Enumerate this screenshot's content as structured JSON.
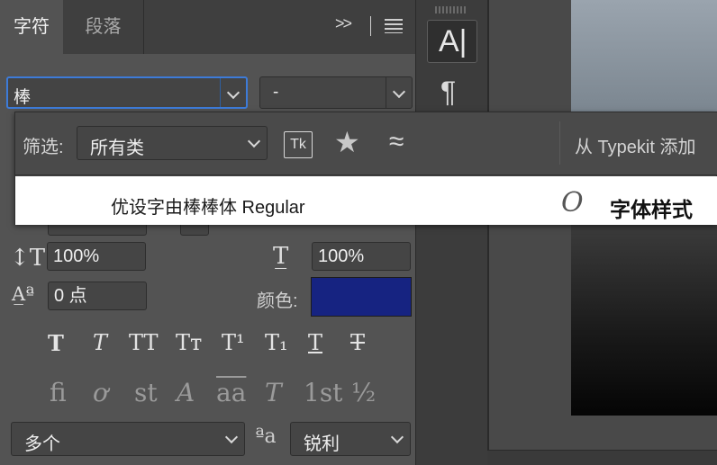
{
  "tabs": [
    "字符",
    "段落"
  ],
  "panel_controls": {
    "expand": ">>",
    "menu": "panel-menu-icon"
  },
  "font_family": {
    "value": "棒"
  },
  "font_style": {
    "value": "-"
  },
  "vertical_scale": "100%",
  "horizontal_scale": "100%",
  "baseline_shift": "0 点",
  "color": {
    "label": "颜色:",
    "swatch": "#162381"
  },
  "type_buttons": [
    "T",
    "T",
    "TT",
    "Tт",
    "T¹",
    "T₁",
    "T",
    "T"
  ],
  "opentype_buttons": [
    "ﬁ",
    "ơ",
    "st",
    "A",
    "aa",
    "T",
    "1st",
    "½"
  ],
  "language": {
    "value": "多个"
  },
  "anti_alias": {
    "icon": "ªa",
    "value": "锐利"
  },
  "side_strip": {
    "character_button": "A|",
    "paragraph_button": "¶"
  },
  "popup": {
    "filter_label": "筛选:",
    "category": "所有类",
    "typekit_label": "Tk",
    "typekit_add": "从 Typekit 添加",
    "result": {
      "name": "优设字由棒棒体 Regular",
      "type_glyph": "O",
      "sample": "字体样式"
    }
  }
}
